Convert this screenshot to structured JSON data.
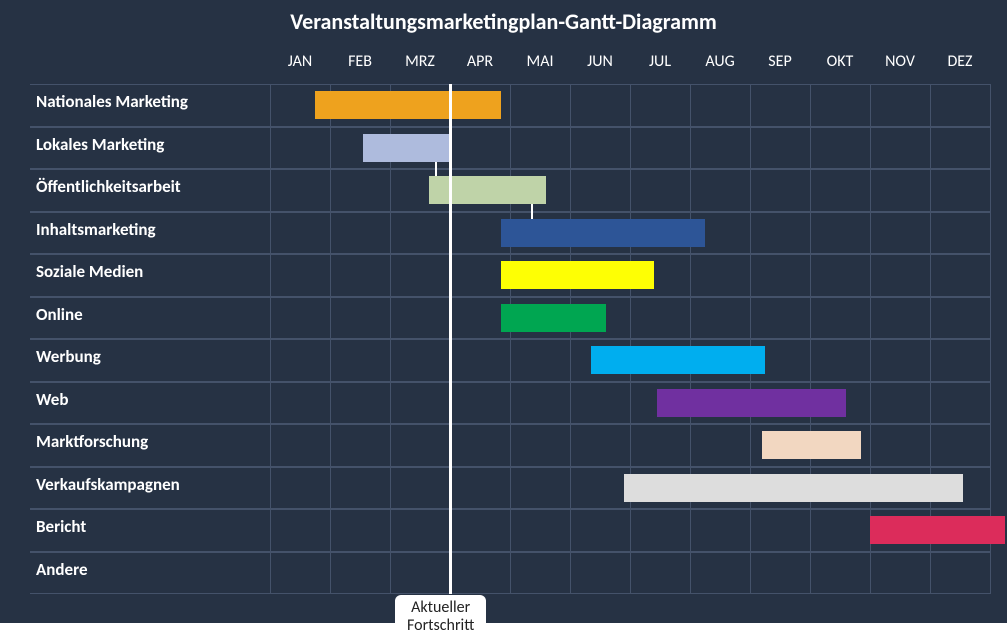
{
  "chart_data": {
    "type": "bar",
    "title": "Veranstaltungsmarketingplan-Gantt-Diagramm",
    "categories": [
      "JAN",
      "FEB",
      "MRZ",
      "APR",
      "MAI",
      "JUN",
      "JUL",
      "AUG",
      "SEP",
      "OKT",
      "NOV",
      "DEZ"
    ],
    "xlabel": "",
    "ylabel": "",
    "ylim": [
      0,
      12
    ],
    "series": [
      {
        "name": "Nationales Marketing",
        "start": 0.75,
        "end": 3.85,
        "color": "#eea21e"
      },
      {
        "name": "Lokales Marketing",
        "start": 1.55,
        "end": 3.0,
        "color": "#aebbdd"
      },
      {
        "name": "Öffentlichkeitsarbeit",
        "start": 2.65,
        "end": 4.6,
        "color": "#bfd3a8"
      },
      {
        "name": "Inhaltsmarketing",
        "start": 3.85,
        "end": 7.25,
        "color": "#2d5597"
      },
      {
        "name": "Soziale Medien",
        "start": 3.85,
        "end": 6.4,
        "color": "#feff04"
      },
      {
        "name": "Online",
        "start": 3.85,
        "end": 5.6,
        "color": "#00a651"
      },
      {
        "name": "Werbung",
        "start": 5.35,
        "end": 8.25,
        "color": "#00aeef"
      },
      {
        "name": "Web",
        "start": 6.45,
        "end": 9.6,
        "color": "#7030a0"
      },
      {
        "name": "Marktforschung",
        "start": 8.2,
        "end": 9.85,
        "color": "#f2d7c1"
      },
      {
        "name": "Verkaufskampagnen",
        "start": 5.9,
        "end": 11.55,
        "color": "#dddddd"
      },
      {
        "name": "Bericht",
        "start": 10.0,
        "end": 12.25,
        "color": "#dc2c5b"
      },
      {
        "name": "Andere",
        "start": 0.0,
        "end": 0.0,
        "color": "#ffffff"
      }
    ],
    "dependencies": [
      {
        "from": 1,
        "to": 2
      },
      {
        "from": 2,
        "to": 3
      }
    ],
    "marker": {
      "x": 3.0,
      "label": "Aktueller\nFortschritt"
    },
    "bg": "#263244",
    "grid": "#44526a"
  }
}
